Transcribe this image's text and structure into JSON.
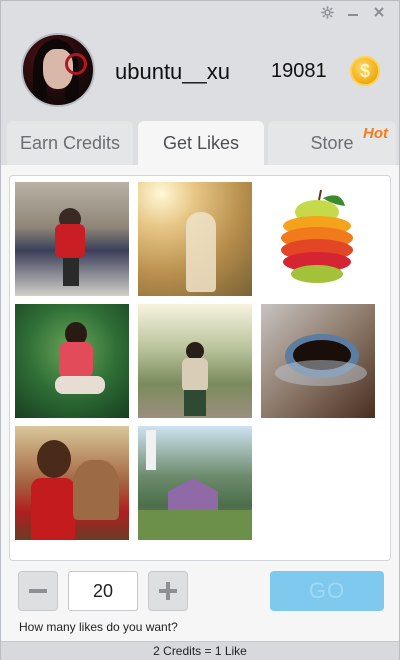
{
  "header": {
    "username": "ubuntu__xu",
    "credits": "19081",
    "coin_symbol": "$"
  },
  "window_controls": [
    {
      "name": "settings",
      "icon": "gear-icon"
    },
    {
      "name": "minimize",
      "icon": "minimize-icon"
    },
    {
      "name": "close",
      "icon": "close-icon"
    }
  ],
  "tabs": [
    {
      "label": "Earn Credits",
      "active": false
    },
    {
      "label": "Get Likes",
      "active": true
    },
    {
      "label": "Store",
      "active": false,
      "badge": "Hot"
    }
  ],
  "gallery": {
    "photos": [
      {
        "description_icon": "photo-girl-red-scarf"
      },
      {
        "description_icon": "photo-sunny-girl"
      },
      {
        "description_icon": "photo-sliced-fruit"
      },
      {
        "description_icon": "photo-girl-grass"
      },
      {
        "description_icon": "photo-girl-park-path"
      },
      {
        "description_icon": "photo-coffee-beans"
      },
      {
        "description_icon": "photo-girl-with-dog"
      },
      {
        "description_icon": "photo-cottage-painting"
      }
    ]
  },
  "controls": {
    "quantity": "20",
    "go_label": "GO",
    "hint": "How many likes do you want?"
  },
  "footer": {
    "rate": "2 Credits = 1 Like"
  },
  "colors": {
    "accent_go": "#7fc9ee",
    "hot_badge": "#f57b1d",
    "coin": "#f3b21d"
  }
}
